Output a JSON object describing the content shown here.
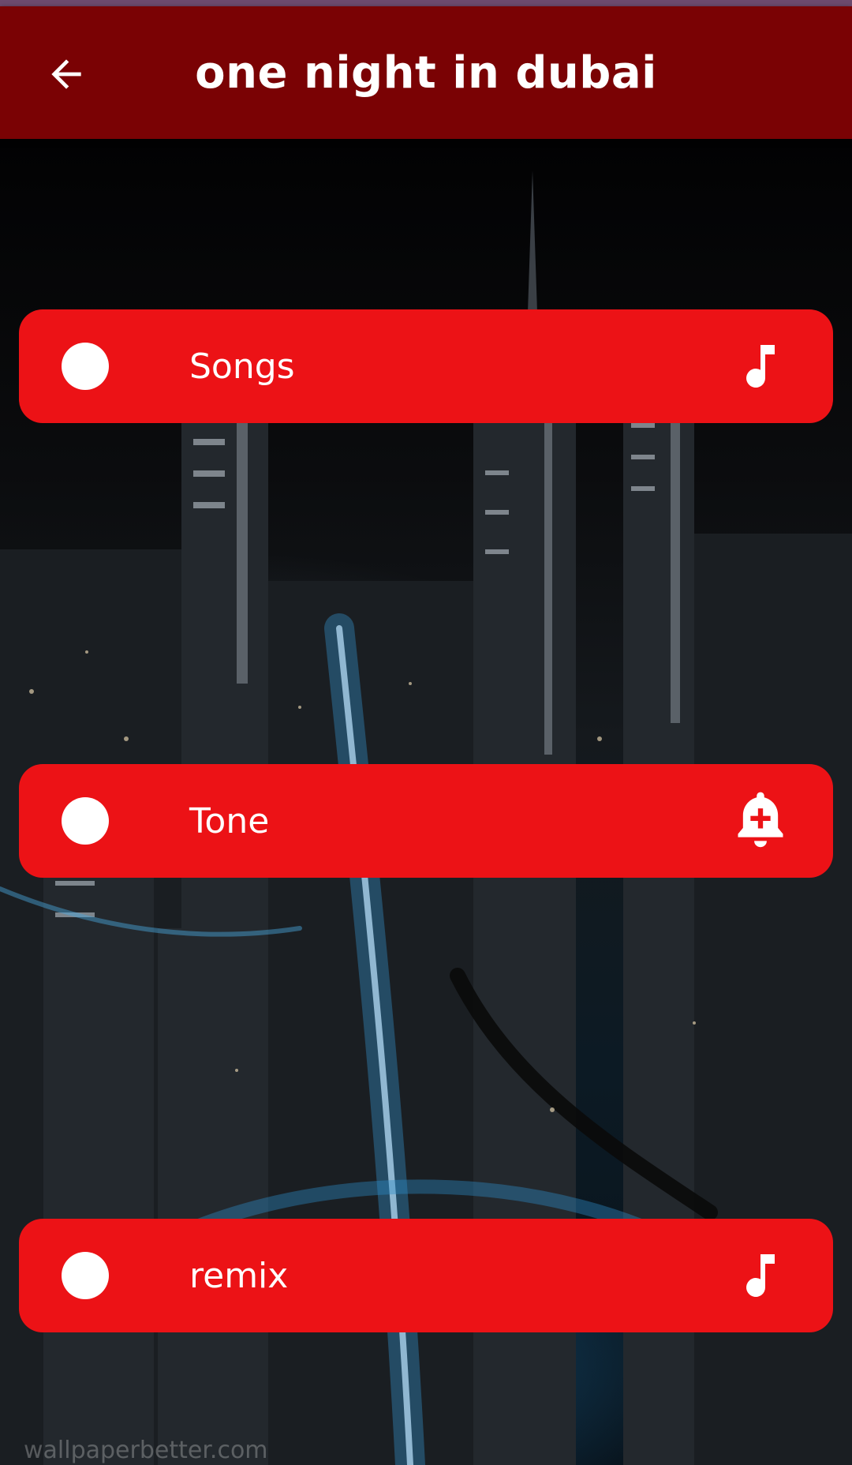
{
  "appbar": {
    "title": "one night in dubai",
    "back_icon": "arrow-left-icon",
    "background_color": "#7a0204"
  },
  "menu": {
    "accent_color": "#ec1216",
    "items": [
      {
        "label": "Songs",
        "leading_icon": "circle-dot-icon",
        "trailing_icon": "music-note-icon"
      },
      {
        "label": "Tone",
        "leading_icon": "circle-dot-icon",
        "trailing_icon": "bell-plus-icon"
      },
      {
        "label": "remix",
        "leading_icon": "circle-dot-icon",
        "trailing_icon": "music-note-icon"
      }
    ]
  },
  "background": {
    "watermark": "wallpaperbetter.com"
  }
}
